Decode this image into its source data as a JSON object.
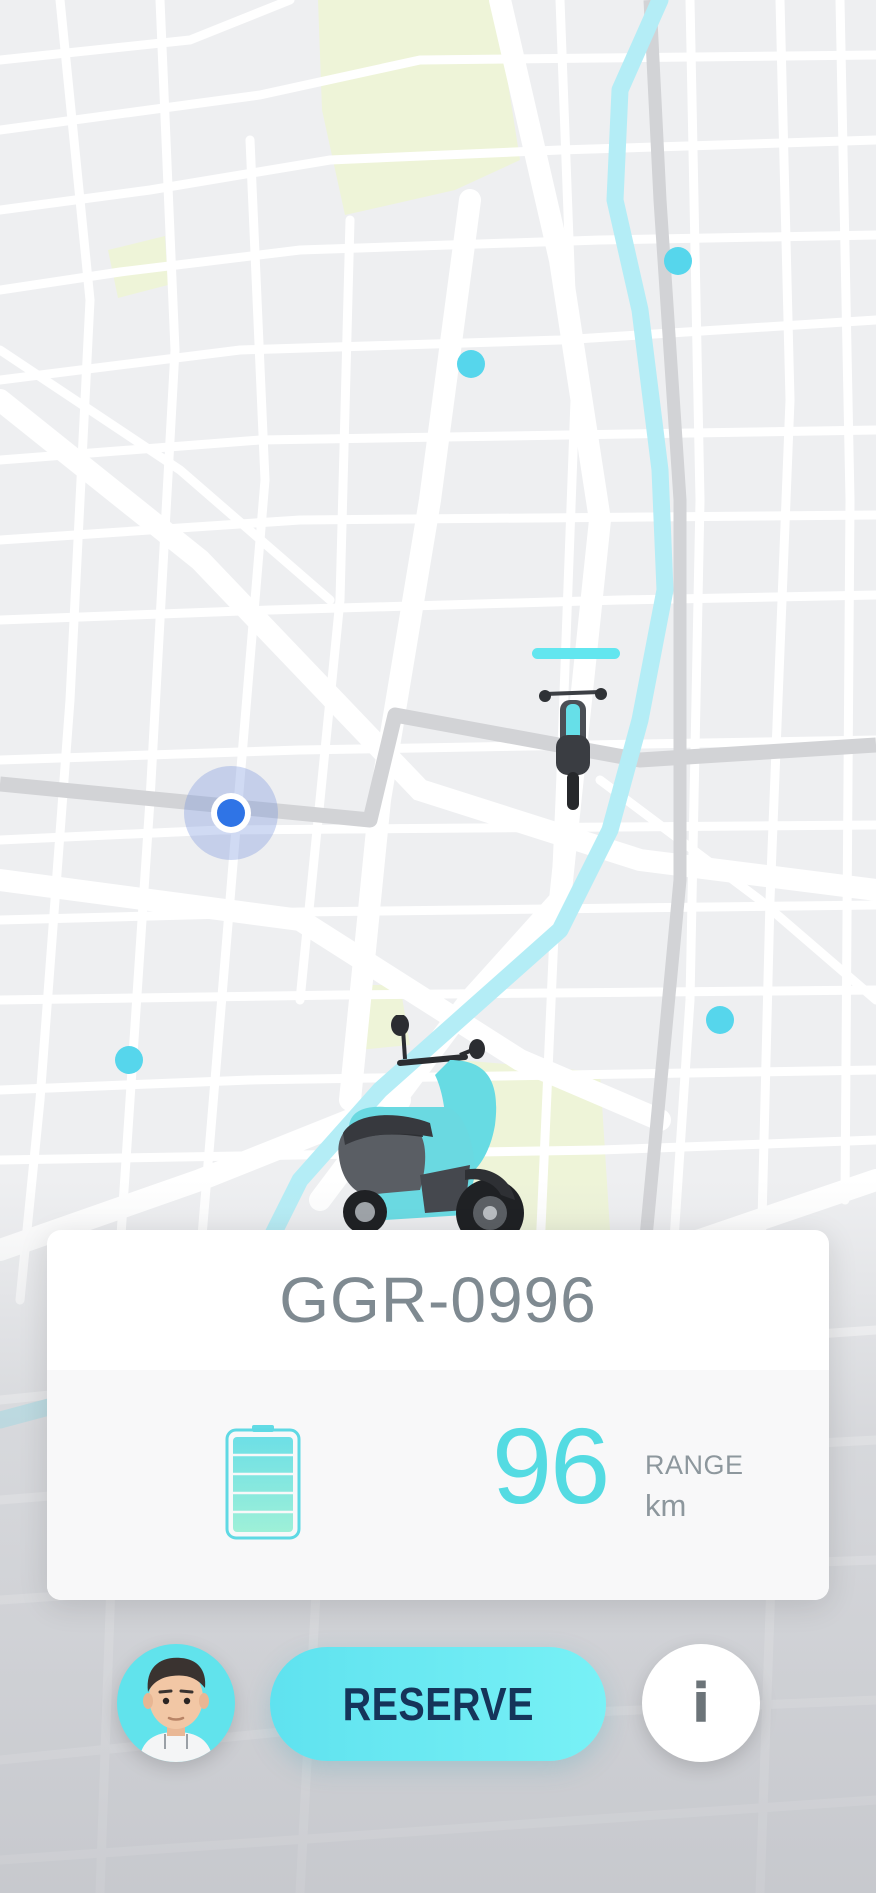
{
  "vehicle": {
    "plate": "GGR-0996",
    "battery_level": 1.0,
    "range_value": "96",
    "range_label": "RANGE",
    "range_unit": "km"
  },
  "actions": {
    "reserve_label": "RESERVE",
    "info_label": "i"
  },
  "map": {
    "scooter_markers": 4,
    "colors": {
      "marker": "#56d6ec",
      "user_location": "#2f74e6",
      "river": "#b4edf6",
      "park": "#eef4d8",
      "route": "#d2d3d6"
    }
  },
  "icons": [
    "battery-icon",
    "user-avatar-icon",
    "info-icon",
    "scooter-icon",
    "location-dot-icon"
  ],
  "colors": {
    "accent": "#5fe2ef",
    "range_text": "#54dbe2",
    "button_text": "#15345a"
  }
}
